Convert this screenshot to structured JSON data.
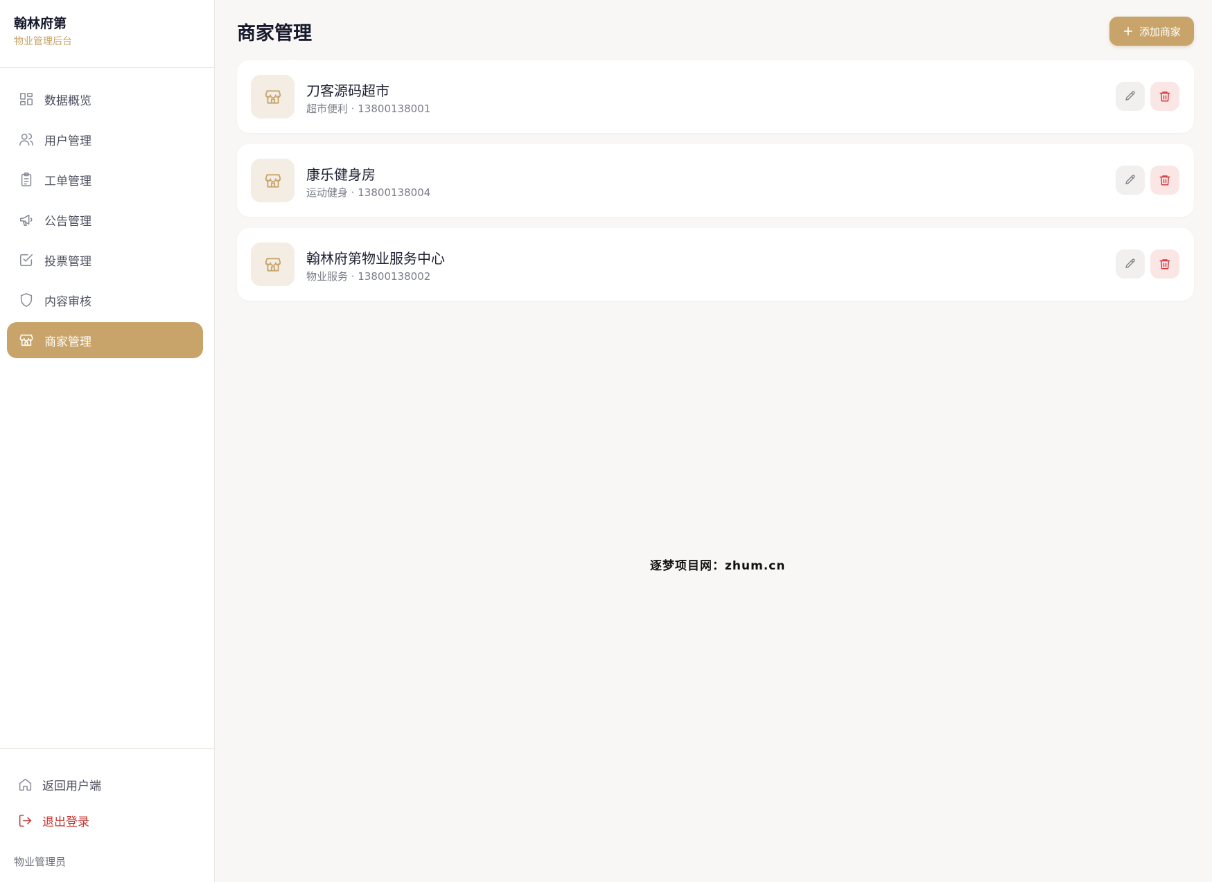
{
  "brand": {
    "title": "翰林府第",
    "subtitle": "物业管理后台"
  },
  "nav": {
    "items": [
      {
        "label": "数据概览",
        "icon": "dashboard-grid-icon",
        "active": false
      },
      {
        "label": "用户管理",
        "icon": "users-icon",
        "active": false
      },
      {
        "label": "工单管理",
        "icon": "clipboard-icon",
        "active": false
      },
      {
        "label": "公告管理",
        "icon": "megaphone-icon",
        "active": false
      },
      {
        "label": "投票管理",
        "icon": "checkbox-icon",
        "active": false
      },
      {
        "label": "内容审核",
        "icon": "shield-icon",
        "active": false
      },
      {
        "label": "商家管理",
        "icon": "store-icon",
        "active": true
      }
    ]
  },
  "sidebar_bottom": {
    "back_label": "返回用户端",
    "logout_label": "退出登录",
    "role": "物业管理员"
  },
  "main": {
    "title": "商家管理",
    "add_button_label": "添加商家"
  },
  "merchants": [
    {
      "name": "刀客源码超市",
      "meta": "超市便利 · 13800138001"
    },
    {
      "name": "康乐健身房",
      "meta": "运动健身 · 13800138004"
    },
    {
      "name": "翰林府第物业服务中心",
      "meta": "物业服务 · 13800138002"
    }
  ],
  "watermark": "逐梦项目网：zhum.cn",
  "colors": {
    "accent": "#c8a46a",
    "danger": "#c23a36",
    "background": "#f8f7f5"
  }
}
